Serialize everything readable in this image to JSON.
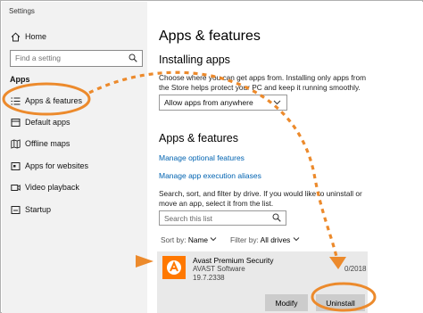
{
  "window": {
    "title": "Settings"
  },
  "sidebar": {
    "home_label": "Home",
    "search_placeholder": "Find a setting",
    "section_label": "Apps",
    "items": [
      {
        "label": "Apps & features"
      },
      {
        "label": "Default apps"
      },
      {
        "label": "Offline maps"
      },
      {
        "label": "Apps for websites"
      },
      {
        "label": "Video playback"
      },
      {
        "label": "Startup"
      }
    ]
  },
  "main": {
    "title": "Apps & features",
    "installing": {
      "heading": "Installing apps",
      "description": "Choose where you can get apps from. Installing only apps from the Store helps protect your PC and keep it running smoothly.",
      "dropdown_value": "Allow apps from anywhere"
    },
    "apps_features": {
      "heading": "Apps & features",
      "link_optional": "Manage optional features",
      "link_aliases": "Manage app execution aliases",
      "description": "Search, sort, and filter by drive. If you would like to uninstall or move an app, select it from the list.",
      "search_placeholder": "Search this list",
      "sort_label": "Sort by:",
      "sort_value": "Name",
      "filter_label": "Filter by:",
      "filter_value": "All drives"
    },
    "app": {
      "name": "Avast Premium Security",
      "publisher": "AVAST Software",
      "version": "19.7.2338",
      "date_visible": "0/2018",
      "modify_label": "Modify",
      "uninstall_label": "Uninstall"
    }
  },
  "colors": {
    "annotation_orange": "#ec8a2c",
    "link_blue": "#0063b1",
    "avast_orange": "#ff7800"
  }
}
